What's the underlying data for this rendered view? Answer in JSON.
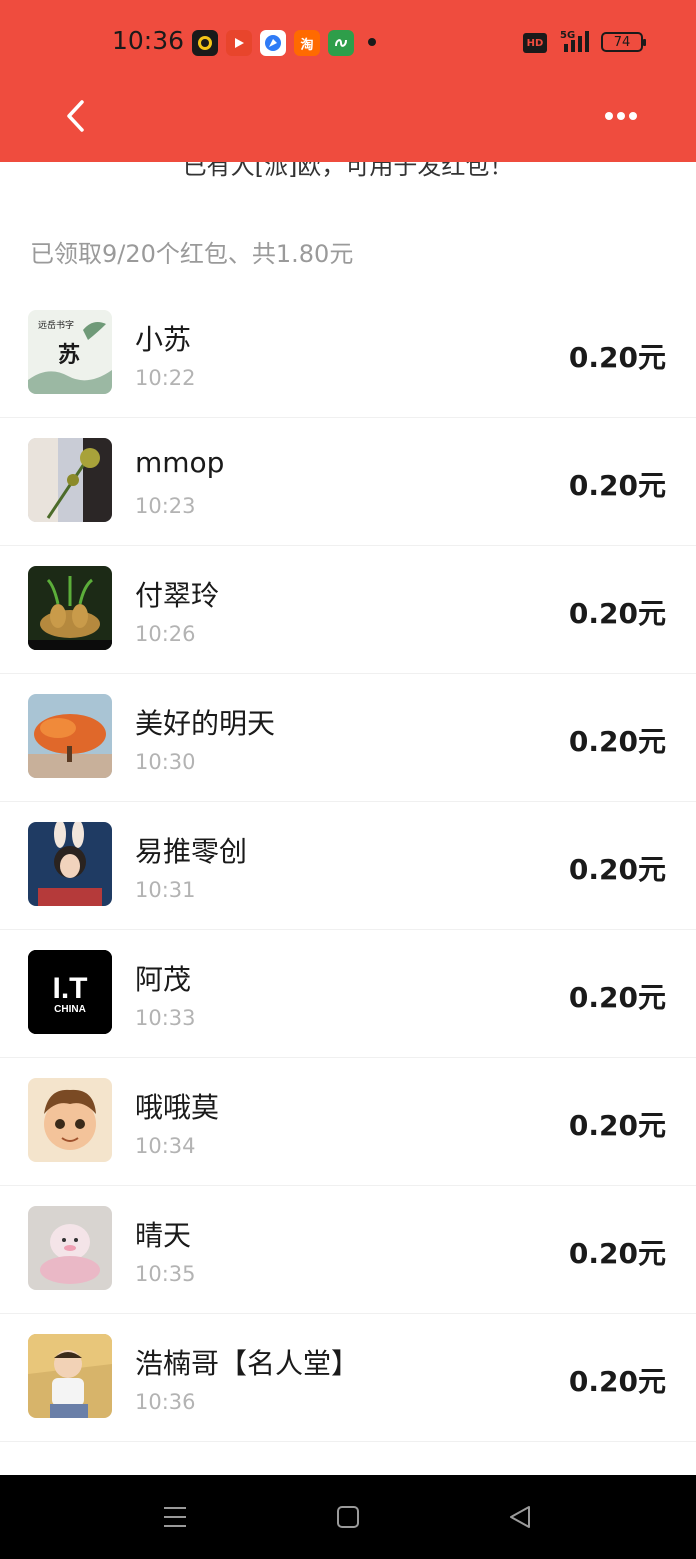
{
  "status_bar": {
    "time": "10:36",
    "hd": "HD",
    "network": "5G",
    "battery": "74",
    "app_icons": [
      {
        "name": "app-icon-1",
        "color": "#1a1a1a",
        "glyph": "◐"
      },
      {
        "name": "app-icon-2",
        "color": "#E8452C",
        "glyph": "▶"
      },
      {
        "name": "app-icon-3",
        "color": "#2F7BF6",
        "glyph": "◉"
      },
      {
        "name": "taobao-icon",
        "color": "#FF6A00",
        "glyph": "淘"
      },
      {
        "name": "app-icon-5",
        "color": "#2E9E4A",
        "glyph": "ა"
      }
    ]
  },
  "header": {
    "clipped_text": "已有人[派]欧，可用于发红包！",
    "back_icon": "chevron-left-icon",
    "more_icon": "more-dots-icon"
  },
  "summary": "已领取9/20个红包、共1.80元",
  "colors": {
    "header_bg": "#EF4C3E",
    "text_primary": "#1a1a1a",
    "text_secondary": "#b3b3b3",
    "summary_text": "#9a9a9a"
  },
  "records": [
    {
      "name": "小苏",
      "time": "10:22",
      "amount": "0.20元",
      "avatar": "ink-painting"
    },
    {
      "name": "mmop",
      "time": "10:23",
      "amount": "0.20元",
      "avatar": "flower"
    },
    {
      "name": "付翠玲",
      "time": "10:26",
      "amount": "0.20元",
      "avatar": "sprouts"
    },
    {
      "name": "美好的明天",
      "time": "10:30",
      "amount": "0.20元",
      "avatar": "orange-tree"
    },
    {
      "name": "易推零创",
      "time": "10:31",
      "amount": "0.20元",
      "avatar": "bunny-girl"
    },
    {
      "name": "阿茂",
      "time": "10:33",
      "amount": "0.20元",
      "avatar": "it-china",
      "avatar_text": "I.T",
      "avatar_subtext": "CHINA"
    },
    {
      "name": "哦哦莫",
      "time": "10:34",
      "amount": "0.20元",
      "avatar": "cartoon-boy"
    },
    {
      "name": "晴天",
      "time": "10:35",
      "amount": "0.20元",
      "avatar": "plush-toy"
    },
    {
      "name": "浩楠哥【名人堂】",
      "time": "10:36",
      "amount": "0.20元",
      "avatar": "baby"
    }
  ],
  "navbar": {
    "menu_icon": "menu-icon",
    "home_icon": "home-square-icon",
    "back_icon": "back-triangle-icon"
  }
}
